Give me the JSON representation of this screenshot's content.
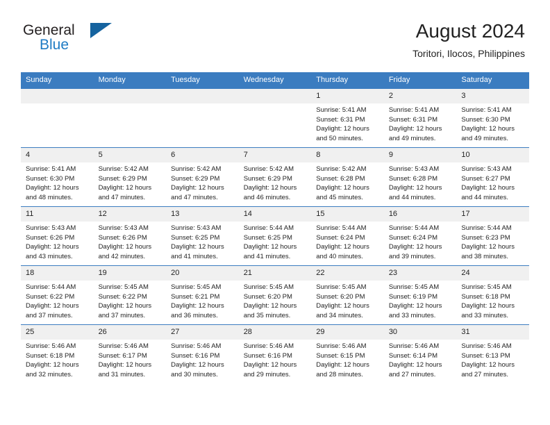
{
  "brand": {
    "name_part1": "General",
    "name_part2": "Blue",
    "logo_icon": "triangle-logo-icon",
    "accent_color": "#15639f"
  },
  "header": {
    "title": "August 2024",
    "subtitle": "Toritori, Ilocos, Philippines"
  },
  "colors": {
    "header_band": "#3b7cc0",
    "daynum_band": "#f0f0f0",
    "text": "#222222"
  },
  "calendar": {
    "weekday_headers": [
      "Sunday",
      "Monday",
      "Tuesday",
      "Wednesday",
      "Thursday",
      "Friday",
      "Saturday"
    ],
    "weeks": [
      [
        {
          "day": "",
          "empty": true
        },
        {
          "day": "",
          "empty": true
        },
        {
          "day": "",
          "empty": true
        },
        {
          "day": "",
          "empty": true
        },
        {
          "day": "1",
          "sunrise": "Sunrise: 5:41 AM",
          "sunset": "Sunset: 6:31 PM",
          "daylight1": "Daylight: 12 hours",
          "daylight2": "and 50 minutes."
        },
        {
          "day": "2",
          "sunrise": "Sunrise: 5:41 AM",
          "sunset": "Sunset: 6:31 PM",
          "daylight1": "Daylight: 12 hours",
          "daylight2": "and 49 minutes."
        },
        {
          "day": "3",
          "sunrise": "Sunrise: 5:41 AM",
          "sunset": "Sunset: 6:30 PM",
          "daylight1": "Daylight: 12 hours",
          "daylight2": "and 49 minutes."
        }
      ],
      [
        {
          "day": "4",
          "sunrise": "Sunrise: 5:41 AM",
          "sunset": "Sunset: 6:30 PM",
          "daylight1": "Daylight: 12 hours",
          "daylight2": "and 48 minutes."
        },
        {
          "day": "5",
          "sunrise": "Sunrise: 5:42 AM",
          "sunset": "Sunset: 6:29 PM",
          "daylight1": "Daylight: 12 hours",
          "daylight2": "and 47 minutes."
        },
        {
          "day": "6",
          "sunrise": "Sunrise: 5:42 AM",
          "sunset": "Sunset: 6:29 PM",
          "daylight1": "Daylight: 12 hours",
          "daylight2": "and 47 minutes."
        },
        {
          "day": "7",
          "sunrise": "Sunrise: 5:42 AM",
          "sunset": "Sunset: 6:29 PM",
          "daylight1": "Daylight: 12 hours",
          "daylight2": "and 46 minutes."
        },
        {
          "day": "8",
          "sunrise": "Sunrise: 5:42 AM",
          "sunset": "Sunset: 6:28 PM",
          "daylight1": "Daylight: 12 hours",
          "daylight2": "and 45 minutes."
        },
        {
          "day": "9",
          "sunrise": "Sunrise: 5:43 AM",
          "sunset": "Sunset: 6:28 PM",
          "daylight1": "Daylight: 12 hours",
          "daylight2": "and 44 minutes."
        },
        {
          "day": "10",
          "sunrise": "Sunrise: 5:43 AM",
          "sunset": "Sunset: 6:27 PM",
          "daylight1": "Daylight: 12 hours",
          "daylight2": "and 44 minutes."
        }
      ],
      [
        {
          "day": "11",
          "sunrise": "Sunrise: 5:43 AM",
          "sunset": "Sunset: 6:26 PM",
          "daylight1": "Daylight: 12 hours",
          "daylight2": "and 43 minutes."
        },
        {
          "day": "12",
          "sunrise": "Sunrise: 5:43 AM",
          "sunset": "Sunset: 6:26 PM",
          "daylight1": "Daylight: 12 hours",
          "daylight2": "and 42 minutes."
        },
        {
          "day": "13",
          "sunrise": "Sunrise: 5:43 AM",
          "sunset": "Sunset: 6:25 PM",
          "daylight1": "Daylight: 12 hours",
          "daylight2": "and 41 minutes."
        },
        {
          "day": "14",
          "sunrise": "Sunrise: 5:44 AM",
          "sunset": "Sunset: 6:25 PM",
          "daylight1": "Daylight: 12 hours",
          "daylight2": "and 41 minutes."
        },
        {
          "day": "15",
          "sunrise": "Sunrise: 5:44 AM",
          "sunset": "Sunset: 6:24 PM",
          "daylight1": "Daylight: 12 hours",
          "daylight2": "and 40 minutes."
        },
        {
          "day": "16",
          "sunrise": "Sunrise: 5:44 AM",
          "sunset": "Sunset: 6:24 PM",
          "daylight1": "Daylight: 12 hours",
          "daylight2": "and 39 minutes."
        },
        {
          "day": "17",
          "sunrise": "Sunrise: 5:44 AM",
          "sunset": "Sunset: 6:23 PM",
          "daylight1": "Daylight: 12 hours",
          "daylight2": "and 38 minutes."
        }
      ],
      [
        {
          "day": "18",
          "sunrise": "Sunrise: 5:44 AM",
          "sunset": "Sunset: 6:22 PM",
          "daylight1": "Daylight: 12 hours",
          "daylight2": "and 37 minutes."
        },
        {
          "day": "19",
          "sunrise": "Sunrise: 5:45 AM",
          "sunset": "Sunset: 6:22 PM",
          "daylight1": "Daylight: 12 hours",
          "daylight2": "and 37 minutes."
        },
        {
          "day": "20",
          "sunrise": "Sunrise: 5:45 AM",
          "sunset": "Sunset: 6:21 PM",
          "daylight1": "Daylight: 12 hours",
          "daylight2": "and 36 minutes."
        },
        {
          "day": "21",
          "sunrise": "Sunrise: 5:45 AM",
          "sunset": "Sunset: 6:20 PM",
          "daylight1": "Daylight: 12 hours",
          "daylight2": "and 35 minutes."
        },
        {
          "day": "22",
          "sunrise": "Sunrise: 5:45 AM",
          "sunset": "Sunset: 6:20 PM",
          "daylight1": "Daylight: 12 hours",
          "daylight2": "and 34 minutes."
        },
        {
          "day": "23",
          "sunrise": "Sunrise: 5:45 AM",
          "sunset": "Sunset: 6:19 PM",
          "daylight1": "Daylight: 12 hours",
          "daylight2": "and 33 minutes."
        },
        {
          "day": "24",
          "sunrise": "Sunrise: 5:45 AM",
          "sunset": "Sunset: 6:18 PM",
          "daylight1": "Daylight: 12 hours",
          "daylight2": "and 33 minutes."
        }
      ],
      [
        {
          "day": "25",
          "sunrise": "Sunrise: 5:46 AM",
          "sunset": "Sunset: 6:18 PM",
          "daylight1": "Daylight: 12 hours",
          "daylight2": "and 32 minutes."
        },
        {
          "day": "26",
          "sunrise": "Sunrise: 5:46 AM",
          "sunset": "Sunset: 6:17 PM",
          "daylight1": "Daylight: 12 hours",
          "daylight2": "and 31 minutes."
        },
        {
          "day": "27",
          "sunrise": "Sunrise: 5:46 AM",
          "sunset": "Sunset: 6:16 PM",
          "daylight1": "Daylight: 12 hours",
          "daylight2": "and 30 minutes."
        },
        {
          "day": "28",
          "sunrise": "Sunrise: 5:46 AM",
          "sunset": "Sunset: 6:16 PM",
          "daylight1": "Daylight: 12 hours",
          "daylight2": "and 29 minutes."
        },
        {
          "day": "29",
          "sunrise": "Sunrise: 5:46 AM",
          "sunset": "Sunset: 6:15 PM",
          "daylight1": "Daylight: 12 hours",
          "daylight2": "and 28 minutes."
        },
        {
          "day": "30",
          "sunrise": "Sunrise: 5:46 AM",
          "sunset": "Sunset: 6:14 PM",
          "daylight1": "Daylight: 12 hours",
          "daylight2": "and 27 minutes."
        },
        {
          "day": "31",
          "sunrise": "Sunrise: 5:46 AM",
          "sunset": "Sunset: 6:13 PM",
          "daylight1": "Daylight: 12 hours",
          "daylight2": "and 27 minutes."
        }
      ]
    ]
  }
}
